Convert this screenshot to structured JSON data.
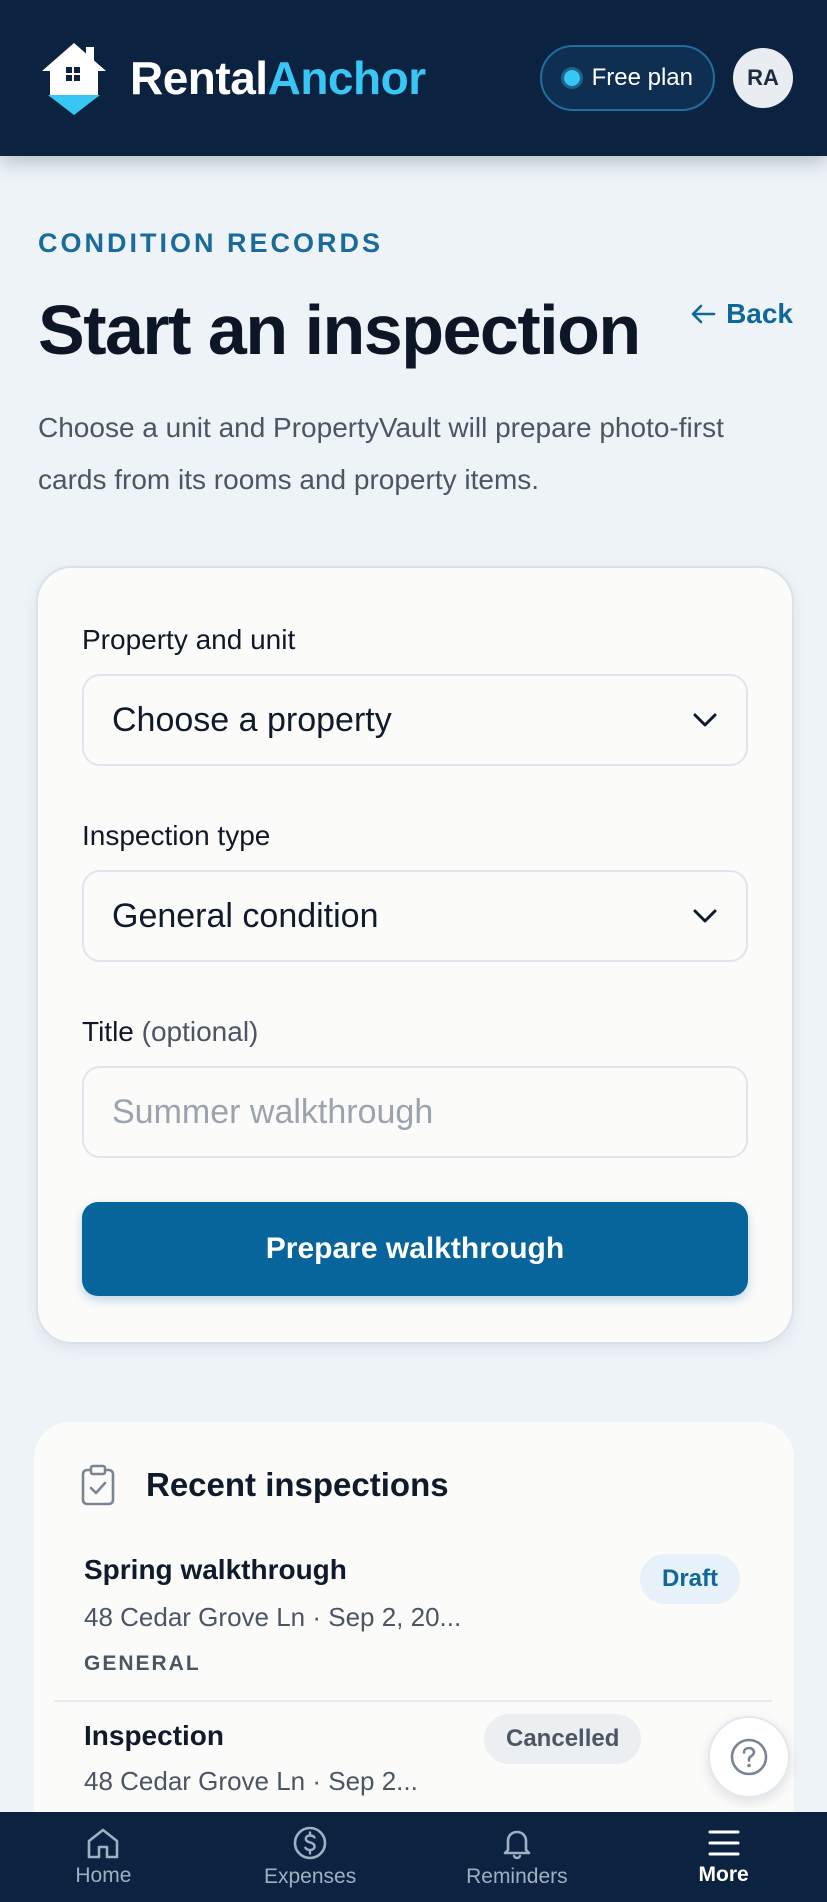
{
  "header": {
    "brand_part1": "Rental",
    "brand_part2": "Anchor",
    "plan_label": "Free plan",
    "avatar_initials": "RA"
  },
  "page": {
    "eyebrow": "CONDITION RECORDS",
    "title": "Start an inspection",
    "back_label": "Back",
    "intro": "Choose a unit and PropertyVault will prepare photo-first cards from its rooms and property items."
  },
  "form": {
    "property_label": "Property and unit",
    "property_value": "Choose a property",
    "type_label": "Inspection type",
    "type_value": "General condition",
    "title_label": "Title",
    "title_optional": "(optional)",
    "title_placeholder": "Summer walkthrough",
    "submit_label": "Prepare walkthrough"
  },
  "recent": {
    "heading": "Recent inspections",
    "items": [
      {
        "name": "Spring walkthrough",
        "meta": "48 Cedar Grove Ln · Sep 2, 20...",
        "kind": "GENERAL",
        "status": "Draft"
      },
      {
        "name": "Inspection",
        "meta": "48 Cedar Grove Ln · Sep 2...",
        "status": "Cancelled"
      }
    ]
  },
  "nav": {
    "items": [
      {
        "label": "Home",
        "icon": "home-icon"
      },
      {
        "label": "Expenses",
        "icon": "dollar-icon"
      },
      {
        "label": "Reminders",
        "icon": "bell-icon"
      },
      {
        "label": "More",
        "icon": "menu-icon"
      }
    ],
    "active": "More"
  },
  "colors": {
    "navy": "#0b2341",
    "accent": "#38c6f4",
    "primary": "#07659b"
  }
}
